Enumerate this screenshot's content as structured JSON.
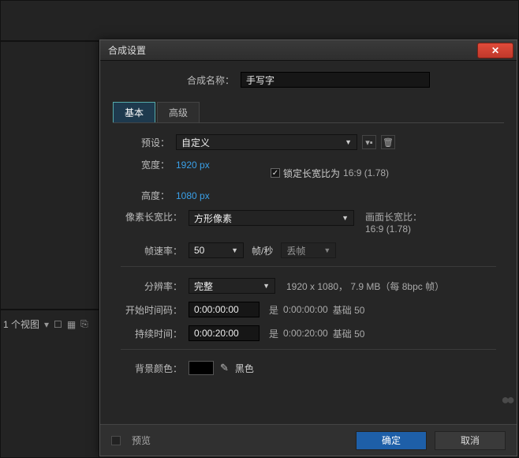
{
  "viewStrip": {
    "label": "1 个视图"
  },
  "dialog": {
    "title": "合成设置",
    "nameLabel": "合成名称：",
    "nameValue": "手写字",
    "tabs": {
      "basic": "基本",
      "advanced": "高级"
    },
    "preset": {
      "label": "预设：",
      "value": "自定义"
    },
    "width": {
      "label": "宽度：",
      "value": "1920 px"
    },
    "height": {
      "label": "高度：",
      "value": "1080 px"
    },
    "lockAspect": {
      "label": "锁定长宽比为",
      "ratio": "16:9 (1.78)"
    },
    "pixelAspect": {
      "label": "像素长宽比：",
      "value": "方形像素"
    },
    "frameAspect": {
      "label": "画面长宽比：",
      "value": "16:9 (1.78)"
    },
    "frameRate": {
      "label": "帧速率：",
      "value": "50",
      "unitLabel": "帧/秒",
      "dropFrame": "丢帧"
    },
    "resolution": {
      "label": "分辨率：",
      "value": "完整",
      "info": "1920 x 1080， 7.9 MB（每 8bpc 帧）"
    },
    "startTimecode": {
      "label": "开始时间码：",
      "value": "0:00:00:00",
      "isLabel": "是",
      "baseValue": "0:00:00:00",
      "baseLabel": "基础 50"
    },
    "duration": {
      "label": "持续时间：",
      "value": "0:00:20:00",
      "isLabel": "是",
      "baseValue": "0:00:20:00",
      "baseLabel": "基础 50"
    },
    "bgColor": {
      "label": "背景颜色：",
      "name": "黑色",
      "hex": "#000000"
    },
    "footer": {
      "preview": "预览",
      "ok": "确定",
      "cancel": "取消"
    }
  }
}
